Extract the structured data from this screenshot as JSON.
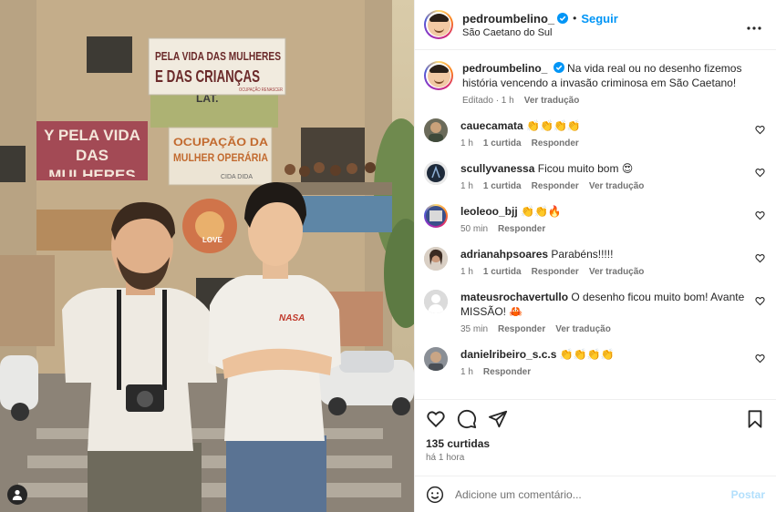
{
  "media": {
    "banner_top_line1": "PELA VIDA DAS MULHERES",
    "banner_top_line2": "E DAS CRIANÇAS",
    "banner_top_small": "OCUPAÇÃO RENASCER",
    "banner_left": "Y PELA VIDA DAS MULHERES",
    "banner_mid_line1": "OCUPAÇÃO DA",
    "banner_mid_line2": "MULHER OPERÁRIA",
    "banner_mid_small": "CIDA DIDA",
    "shirt_text": "NASA",
    "wall_text": "LAT.",
    "wall_text2": "LOVE",
    "tag_icon": "user-tag-icon"
  },
  "header": {
    "username": "pedroumbelino_",
    "dot": "•",
    "follow": "Seguir",
    "location": "São Caetano do Sul",
    "more_icon": "more-options-icon"
  },
  "caption": {
    "username": "pedroumbelino_",
    "text": "Na vida real ou no desenho fizemos história vencendo a invasão criminosa em São Caetano!",
    "edited": "Editado · 1 h",
    "translate": "Ver tradução"
  },
  "comments": [
    {
      "username": "cauecamata",
      "text": "👏👏👏👏",
      "time": "1 h",
      "likes": "1 curtida",
      "reply": "Responder",
      "translate": "",
      "avatar_color": "#6b6b5a"
    },
    {
      "username": "scullyvanessa",
      "text": "Ficou muito bom 😍",
      "time": "1 h",
      "likes": "1 curtida",
      "reply": "Responder",
      "translate": "Ver tradução",
      "avatar_color": "#1e2a3a"
    },
    {
      "username": "leoleoo_bjj",
      "text": "👏👏🔥",
      "time": "50 min",
      "likes": "",
      "reply": "Responder",
      "translate": "",
      "avatar_color": "#3a4f8a"
    },
    {
      "username": "adrianahpsoares",
      "text": "Parabéns!!!!!",
      "time": "1 h",
      "likes": "1 curtida",
      "reply": "Responder",
      "translate": "Ver tradução",
      "avatar_color": "#7a5a48"
    },
    {
      "username": "mateusrochavertullo",
      "text": "O desenho ficou muito bom! Avante MISSÃO! 🦀",
      "time": "35 min",
      "likes": "",
      "reply": "Responder",
      "translate": "Ver tradução",
      "avatar_color": "#dbdbdb"
    },
    {
      "username": "danielribeiro_s.c.s",
      "text": "👏👏👏👏",
      "time": "1 h",
      "likes": "",
      "reply": "Responder",
      "translate": "",
      "avatar_color": "#8a8f96"
    }
  ],
  "actions": {
    "like_icon": "heart-icon",
    "comment_icon": "comment-icon",
    "share_icon": "share-icon",
    "save_icon": "bookmark-icon",
    "likes": "135 curtidas",
    "time": "há 1 hora"
  },
  "composer": {
    "emoji_icon": "emoji-icon",
    "placeholder": "Adicione um comentário...",
    "post": "Postar"
  },
  "colors": {
    "accent": "#0095f6",
    "post_disabled": "#b2dffc",
    "meta": "#737373"
  }
}
